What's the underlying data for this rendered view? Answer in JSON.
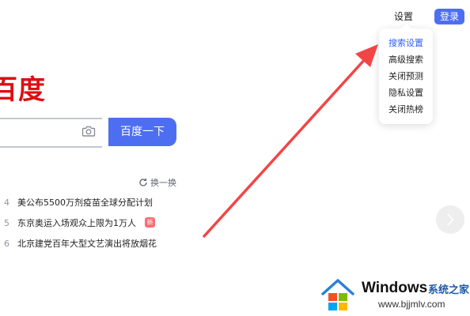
{
  "header": {
    "settings_label": "设置",
    "login_label": "登录"
  },
  "settings_menu": {
    "items": [
      {
        "label": "搜索设置",
        "active": true
      },
      {
        "label": "高级搜索"
      },
      {
        "label": "关闭预测"
      },
      {
        "label": "隐私设置"
      },
      {
        "label": "关闭热榜"
      }
    ]
  },
  "logo": {
    "text": "百度"
  },
  "search": {
    "value": "",
    "button_label": "百度一下",
    "camera_icon": "camera-icon"
  },
  "hot_list": {
    "refresh_label": "换一换",
    "items": [
      {
        "rank": "4",
        "title": "美公布5500万剂疫苗全球分配计划"
      },
      {
        "rank": "5",
        "title": "东京奥运入场观众上限为1万人",
        "badge": "新"
      },
      {
        "rank": "6",
        "title": "北京建党百年大型文艺演出将放烟花"
      }
    ]
  },
  "watermark": {
    "brand": "Windows",
    "site_name": "系统之家",
    "url": "www.bjjmlv.com"
  },
  "colors": {
    "accent": "#4e6ef2",
    "brand_red": "#de0e12",
    "annotation_red": "#f24545"
  }
}
